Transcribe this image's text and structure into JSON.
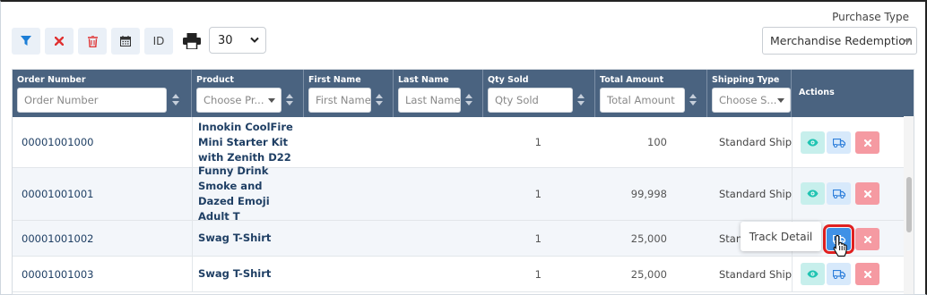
{
  "toolbar": {
    "id_label": "ID",
    "page_size": "30"
  },
  "filters": {
    "purchase_type_label": "Purchase Type",
    "purchase_type_value": "Merchandise Redemption"
  },
  "columns": {
    "order_number": "Order Number",
    "product": "Product",
    "first_name": "First Name",
    "last_name": "Last Name",
    "qty_sold": "Qty Sold",
    "total_amount": "Total Amount",
    "shipping_type": "Shipping Type",
    "actions": "Actions"
  },
  "placeholders": {
    "order_number": "Order Number",
    "product": "Choose Pr...",
    "first_name": "First Name",
    "last_name": "Last Name",
    "qty_sold": "Qty Sold",
    "total_amount": "Total Amount",
    "shipping_type": "Choose S..."
  },
  "rows": [
    {
      "order": "00001001000",
      "product": "Innokin CoolFire Mini Starter Kit with Zenith D22",
      "qty": "1",
      "amount": "100",
      "shipping": "Standard Shipping"
    },
    {
      "order": "00001001001",
      "product": "Funny Drink Smoke and Dazed Emoji Adult T",
      "qty": "1",
      "amount": "99,998",
      "shipping": "Standard Shipping"
    },
    {
      "order": "00001001002",
      "product": "Swag T-Shirt",
      "qty": "1",
      "amount": "25,000",
      "shipping": "Standard Shipping"
    },
    {
      "order": "00001001003",
      "product": "Swag T-Shirt",
      "qty": "1",
      "amount": "25,000",
      "shipping": "Standard Shipping"
    }
  ],
  "tooltip": "Track Detail",
  "colors": {
    "header_bg": "#4a6380",
    "accent_blue": "#3f91e6",
    "delete_red": "#f59aa2",
    "view_teal": "#c7efec",
    "highlight_outline": "#e02020"
  }
}
